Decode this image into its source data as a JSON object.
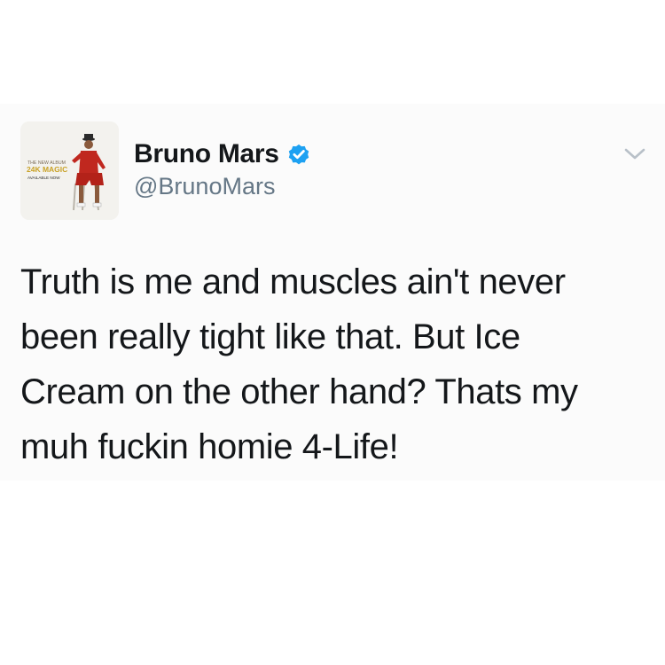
{
  "author": {
    "display_name": "Bruno Mars",
    "handle": "@BrunoMars",
    "verified": true,
    "verified_color": "#1da1f2",
    "avatar": {
      "promo_line1": "THE NEW ALBUM",
      "promo_title": "24K MAGIC",
      "promo_line3": "AVAILABLE NOW",
      "accent_color": "#c9a227"
    }
  },
  "tweet": {
    "text": "Truth is me and muscles ain't never\nbeen really tight like that. But Ice\nCream on the other hand? Thats my\nmuh fuckin homie 4-Life!"
  },
  "menu": {
    "icon": "chevron-down-icon"
  }
}
